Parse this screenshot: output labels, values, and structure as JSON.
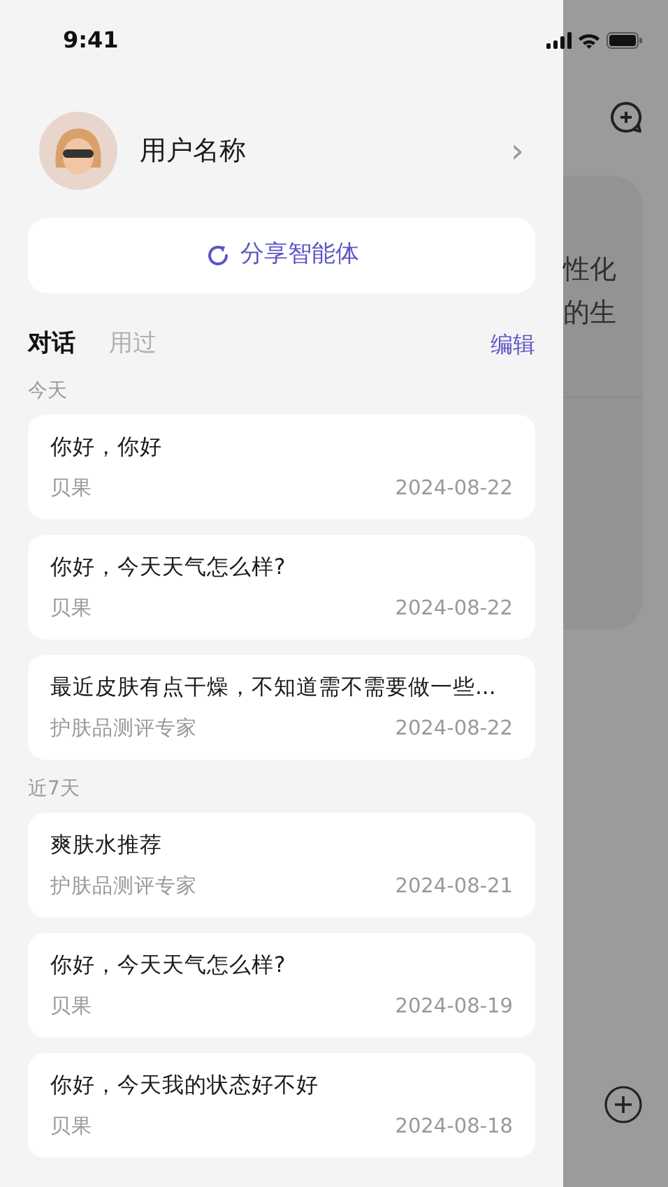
{
  "status_bar": {
    "time": "9:41"
  },
  "profile": {
    "name": "用户名称",
    "chevron": "›"
  },
  "share_button": {
    "label": "分享智能体"
  },
  "tabs": [
    {
      "label": "对话",
      "selected": true
    },
    {
      "label": "用过",
      "selected": false
    }
  ],
  "edit_link": "编辑",
  "groups": [
    {
      "heading": "今天",
      "conversations": [
        {
          "title": "你好，你好",
          "agent": "贝果",
          "date": "2024-08-22"
        },
        {
          "title": "你好，今天天气怎么样?",
          "agent": "贝果",
          "date": "2024-08-22"
        },
        {
          "title": "最近皮肤有点干燥，不知道需不需要做一些...",
          "agent": "护肤品测评专家",
          "date": "2024-08-22"
        }
      ]
    },
    {
      "heading": "近7天",
      "conversations": [
        {
          "title": "爽肤水推荐",
          "agent": "护肤品测评专家",
          "date": "2024-08-21"
        },
        {
          "title": "你好，今天天气怎么样?",
          "agent": "贝果",
          "date": "2024-08-19"
        },
        {
          "title": "你好，今天我的状态好不好",
          "agent": "贝果",
          "date": "2024-08-18"
        }
      ]
    }
  ],
  "background": {
    "texts": [
      "性化",
      "的生"
    ]
  }
}
